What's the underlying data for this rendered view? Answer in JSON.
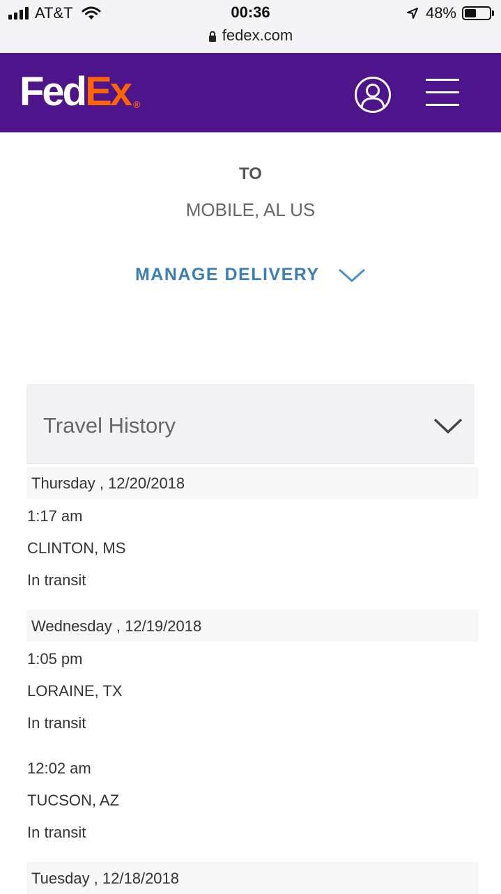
{
  "status_bar": {
    "carrier": "AT&T",
    "time": "00:36",
    "url": "fedex.com",
    "battery_percent": "48%",
    "battery_level": 0.48
  },
  "header": {
    "logo_fed": "Fed",
    "logo_ex": "Ex",
    "logo_reg": "®",
    "brand_color": "#4d148c",
    "accent_color": "#ff6600"
  },
  "destination": {
    "label": "TO",
    "city": "MOBILE, AL US"
  },
  "manage_delivery": {
    "label": "MANAGE DELIVERY",
    "color": "#3b7fb6"
  },
  "travel_history": {
    "title": "Travel History",
    "days": [
      {
        "date": "Thursday , 12/20/2018",
        "events": [
          {
            "time": "1:17 am",
            "location": "CLINTON, MS",
            "status": "In transit"
          }
        ]
      },
      {
        "date": "Wednesday , 12/19/2018",
        "events": [
          {
            "time": "1:05 pm",
            "location": "LORAINE, TX",
            "status": "In transit"
          },
          {
            "time": "12:02 am",
            "location": "TUCSON, AZ",
            "status": "In transit"
          }
        ]
      },
      {
        "date": "Tuesday , 12/18/2018",
        "events": []
      }
    ]
  }
}
